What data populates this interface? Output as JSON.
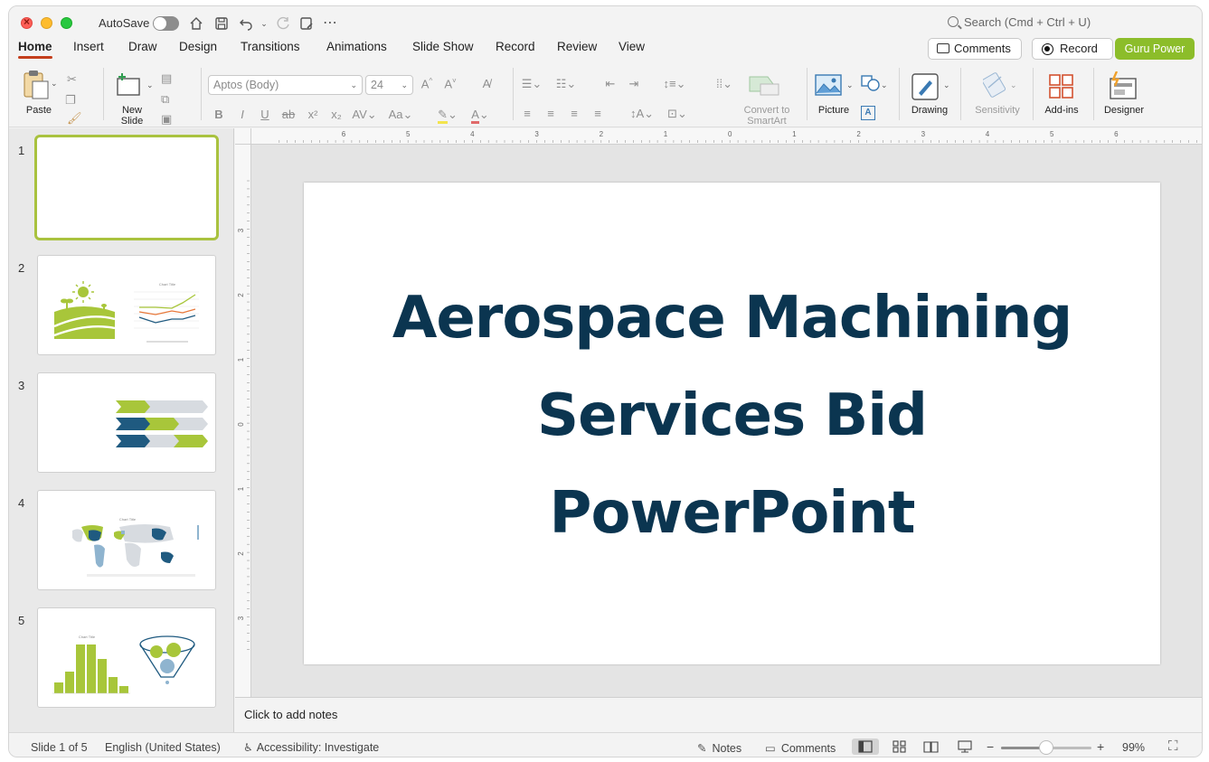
{
  "titlebar": {
    "autosave_label": "AutoSave",
    "search_placeholder": "Search (Cmd + Ctrl + U)"
  },
  "tabs": [
    {
      "label": "Home",
      "active": true
    },
    {
      "label": "Insert"
    },
    {
      "label": "Draw"
    },
    {
      "label": "Design"
    },
    {
      "label": "Transitions"
    },
    {
      "label": "Animations"
    },
    {
      "label": "Slide Show"
    },
    {
      "label": "Record"
    },
    {
      "label": "Review"
    },
    {
      "label": "View"
    }
  ],
  "actions": {
    "comments_label": "Comments",
    "record_label": "Record",
    "guru_label": "Guru Power",
    "guru_color": "#8cbd2a"
  },
  "ribbon": {
    "paste_label": "Paste",
    "new_slide_label": "New\nSlide",
    "font_name": "Aptos (Body)",
    "font_size": "24",
    "convert_label": "Convert to\nSmartArt",
    "picture_label": "Picture",
    "drawing_label": "Drawing",
    "sensitivity_label": "Sensitivity",
    "addins_label": "Add-ins",
    "designer_label": "Designer"
  },
  "slides": [
    {
      "number": "1"
    },
    {
      "number": "2",
      "thumb_chart_title": "Chart Title"
    },
    {
      "number": "3"
    },
    {
      "number": "4",
      "thumb_chart_title": "Chart Title"
    },
    {
      "number": "5",
      "thumb_chart_title": "Chart Title"
    }
  ],
  "current_slide": {
    "title_lines": [
      "Aerospace Machining",
      "Services Bid",
      "PowerPoint"
    ],
    "title_color": "#0b3550"
  },
  "rulers": {
    "horizontal_labels": [
      "6",
      "5",
      "4",
      "3",
      "2",
      "1",
      "0",
      "1",
      "2",
      "3",
      "4",
      "5",
      "6"
    ],
    "vertical_labels": [
      "3",
      "2",
      "1",
      "0",
      "1",
      "2",
      "3"
    ]
  },
  "notes_placeholder": "Click to add notes",
  "status": {
    "slide_info": "Slide 1 of 5",
    "language": "English (United States)",
    "accessibility": "Accessibility: Investigate",
    "notes_label": "Notes",
    "comments_label": "Comments",
    "zoom_level": "99%",
    "zoom_fraction": 0.5
  },
  "palette": {
    "accent_green": "#a9c23f",
    "navy": "#1f5a80",
    "light_gray": "#d7dbe0",
    "chart_green": "#a8c63a",
    "chart_orange": "#e7783a"
  }
}
